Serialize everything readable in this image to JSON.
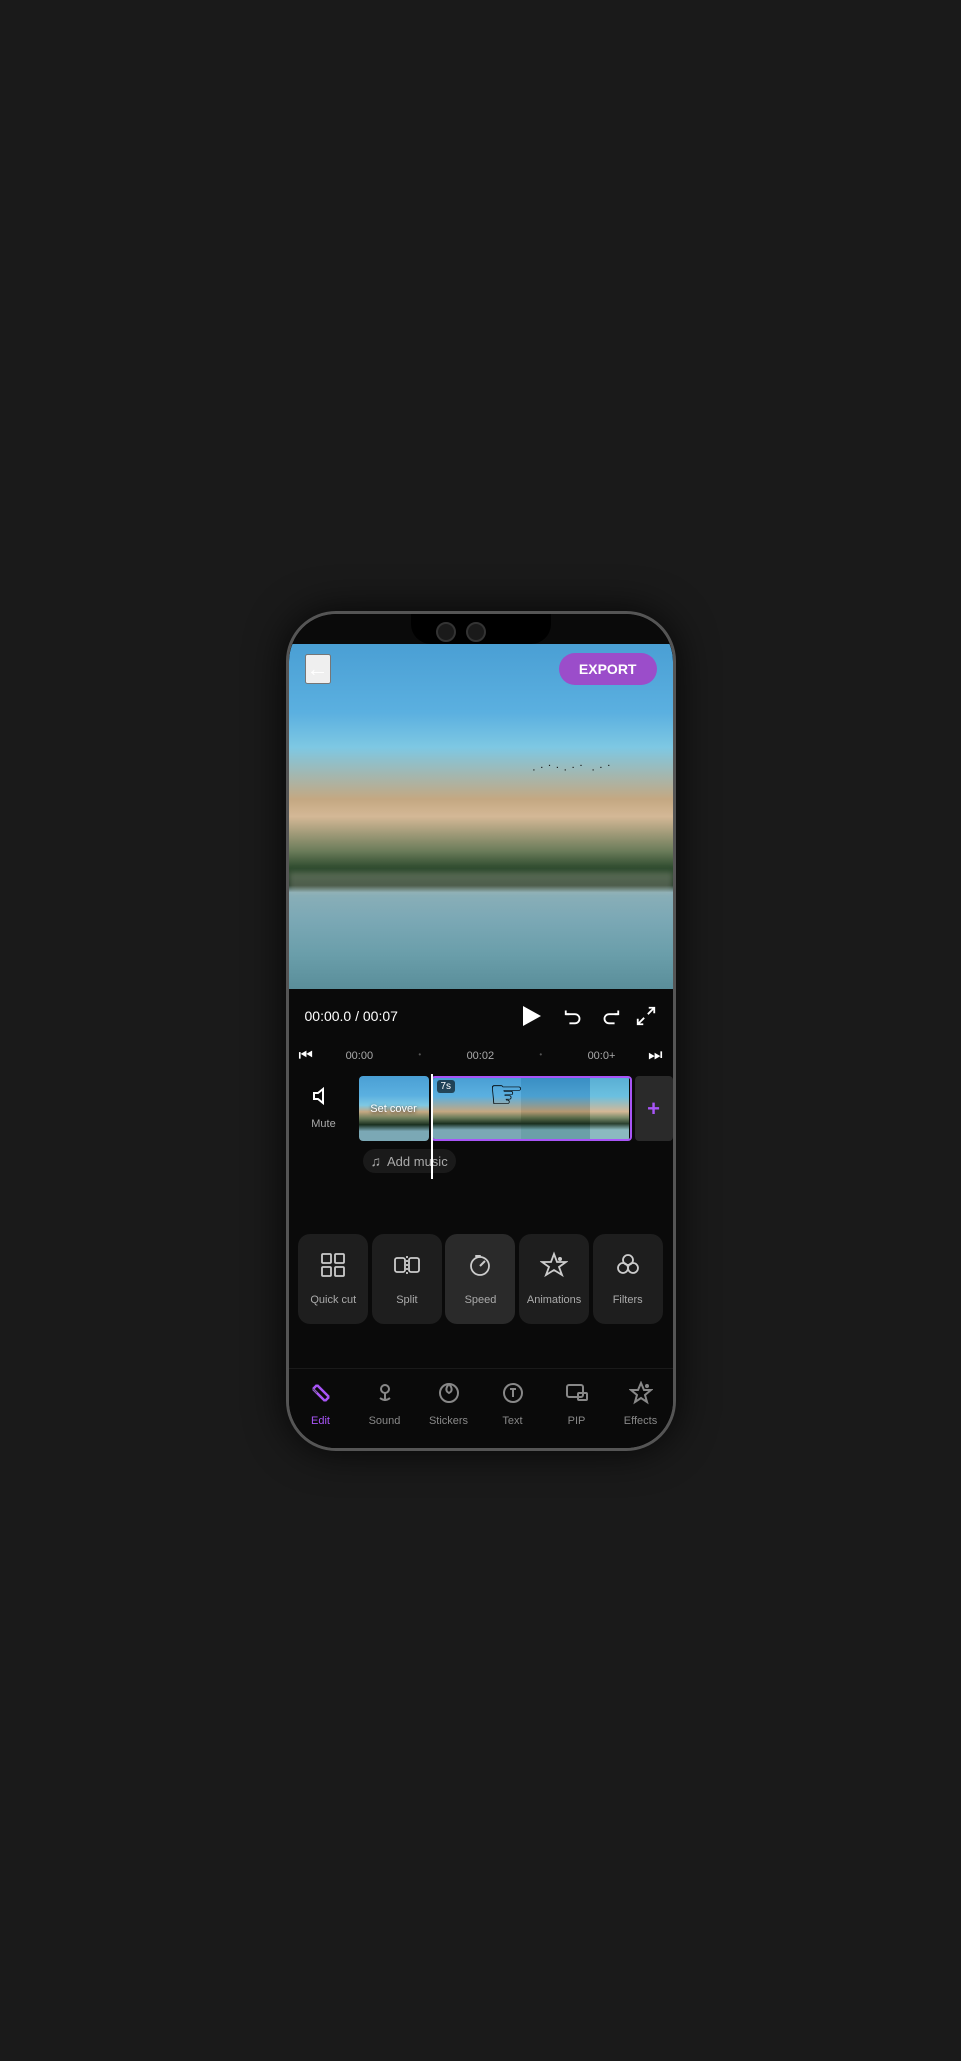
{
  "header": {
    "back_label": "←",
    "export_label": "EXPORT"
  },
  "video": {
    "current_time": "00:00.0",
    "total_time": "00:07",
    "time_separator": " / "
  },
  "ruler": {
    "times": [
      "00:00",
      "00:02",
      "00:0+"
    ]
  },
  "timeline": {
    "mute_label": "Mute",
    "set_cover_label": "Set cover",
    "clip_duration": "7s",
    "add_music_label": "Add music"
  },
  "tools": [
    {
      "key": "quick-cut",
      "label": "Quick cut"
    },
    {
      "key": "split",
      "label": "Split"
    },
    {
      "key": "speed",
      "label": "Speed"
    },
    {
      "key": "animations",
      "label": "Animations"
    },
    {
      "key": "filters",
      "label": "Filters"
    }
  ],
  "bottom_nav": [
    {
      "key": "edit",
      "label": "Edit",
      "active": true
    },
    {
      "key": "sound",
      "label": "Sound",
      "active": false
    },
    {
      "key": "stickers",
      "label": "Stickers",
      "active": false
    },
    {
      "key": "text",
      "label": "Text",
      "active": false
    },
    {
      "key": "pip",
      "label": "PIP",
      "active": false
    },
    {
      "key": "effects",
      "label": "Effects",
      "active": false
    }
  ],
  "colors": {
    "accent": "#9b4dca",
    "text_primary": "#ffffff",
    "text_secondary": "#aaaaaa",
    "background": "#0a0a0a",
    "card_bg": "#1e1e1e"
  }
}
